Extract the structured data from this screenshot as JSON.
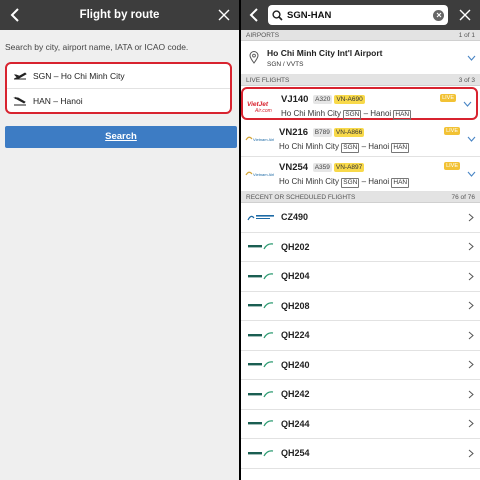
{
  "left": {
    "title": "Flight by route",
    "hint": "Search by city, airport name, IATA or ICAO code.",
    "origin": "SGN – Ho Chi Minh City",
    "destination": "HAN – Hanoi",
    "search_label": "Search"
  },
  "right": {
    "query": "SGN-HAN",
    "airports_header": "AIRPORTS",
    "airports_count": "1 of 1",
    "airport": {
      "name": "Ho Chi Minh City Int'l Airport",
      "code": "SGN / VVTS"
    },
    "live_header": "LIVE FLIGHTS",
    "live_count": "3 of 3",
    "live_flights": [
      {
        "flight": "VJ140",
        "aircraft": "A320",
        "reg": "VN-A690",
        "from": "Ho Chi Minh City",
        "from_code": "SGN",
        "sep": "–",
        "to": "Hanoi",
        "to_code": "HAN",
        "badge": "LIVE",
        "logo_text": "VietJet Air.com"
      },
      {
        "flight": "VN216",
        "aircraft": "B789",
        "reg": "VN-A866",
        "from": "Ho Chi Minh City",
        "from_code": "SGN",
        "sep": "–",
        "to": "Hanoi",
        "to_code": "HAN",
        "badge": "LIVE",
        "logo_text": "Vietnam Airlines"
      },
      {
        "flight": "VN254",
        "aircraft": "A359",
        "reg": "VN-A897",
        "from": "Ho Chi Minh City",
        "from_code": "SGN",
        "sep": "–",
        "to": "Hanoi",
        "to_code": "HAN",
        "badge": "LIVE",
        "logo_text": "Vietnam Airlines"
      }
    ],
    "recent_header": "RECENT OR SCHEDULED FLIGHTS",
    "recent_count": "76 of 76",
    "recent_flights": [
      {
        "flight": "CZ490",
        "logo_text": "CHINA SOUTHERN"
      },
      {
        "flight": "QH202",
        "logo_text": "BAMBOO"
      },
      {
        "flight": "QH204",
        "logo_text": "BAMBOO"
      },
      {
        "flight": "QH208",
        "logo_text": "BAMBOO"
      },
      {
        "flight": "QH224",
        "logo_text": "BAMBOO"
      },
      {
        "flight": "QH240",
        "logo_text": "BAMBOO"
      },
      {
        "flight": "QH242",
        "logo_text": "BAMBOO"
      },
      {
        "flight": "QH244",
        "logo_text": "BAMBOO"
      },
      {
        "flight": "QH254",
        "logo_text": "BAMBOO"
      }
    ]
  },
  "colors": {
    "accent": "#3d7cc4",
    "highlight": "#d8232f",
    "live": "#f2c234",
    "reg": "#f8d94a",
    "topbar": "#3d3d3d"
  },
  "icons": [
    "back-chevron-icon",
    "close-icon",
    "plane-takeoff-icon",
    "plane-landing-icon",
    "search-icon",
    "clear-icon",
    "location-pin-icon",
    "chevron-down-icon",
    "chevron-right-icon"
  ]
}
